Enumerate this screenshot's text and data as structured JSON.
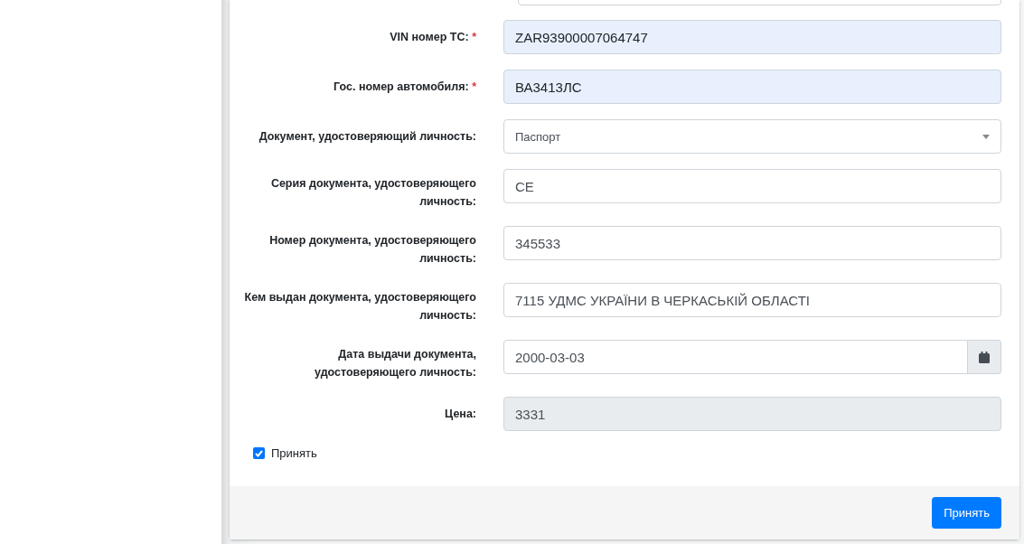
{
  "fields": [
    {
      "label": "VIN номер ТС:",
      "required_mark": "*",
      "kind": "text",
      "value": "ZAR93900007064747",
      "autofilled": true
    },
    {
      "label": "Гос. номер автомобиля:",
      "required_mark": "*",
      "kind": "text",
      "value": "ВА3413ЛС",
      "autofilled": true
    },
    {
      "label": "Документ, удостоверяющий личность:",
      "kind": "select",
      "value": "Паспорт"
    },
    {
      "label": "Серия документа, удостоверяющего личность:",
      "kind": "text",
      "value": "CE",
      "autofilled": false
    },
    {
      "label": "Номер документа, удостоверяющего личность:",
      "kind": "text",
      "value": "345533",
      "autofilled": false
    },
    {
      "label": "Кем выдан документа, удостоверяющего личность:",
      "kind": "text",
      "value": "7115 УДМС УКРАЇНИ В ЧЕРКАСЬКІЙ ОБЛАСТІ",
      "autofilled": false
    },
    {
      "label": "Дата выдачи документа, удостоверяющего личность:",
      "kind": "date",
      "value": "2000-03-03"
    },
    {
      "label": "Цена:",
      "kind": "readonly",
      "value": "3331"
    }
  ],
  "accept_checkbox": {
    "label": "Принять",
    "checked": true
  },
  "submit_button": "Принять"
}
